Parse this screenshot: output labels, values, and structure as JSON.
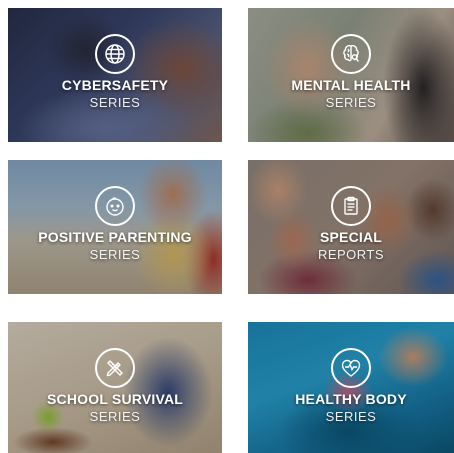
{
  "tiles": [
    {
      "title": "CYBERSAFETY",
      "subtitle": "SERIES",
      "icon": "globe-icon"
    },
    {
      "title": "MENTAL HEALTH",
      "subtitle": "SERIES",
      "icon": "brain-icon"
    },
    {
      "title": "POSITIVE PARENTING",
      "subtitle": "SERIES",
      "icon": "baby-face-icon"
    },
    {
      "title": "SPECIAL",
      "subtitle": "REPORTS",
      "icon": "clipboard-icon"
    },
    {
      "title": "SCHOOL SURVIVAL",
      "subtitle": "SERIES",
      "icon": "pencil-ruler-icon"
    },
    {
      "title": "HEALTHY BODY",
      "subtitle": "SERIES",
      "icon": "heart-pulse-icon"
    }
  ],
  "colors": {
    "text": "#ffffff",
    "overlay": "#000000"
  }
}
